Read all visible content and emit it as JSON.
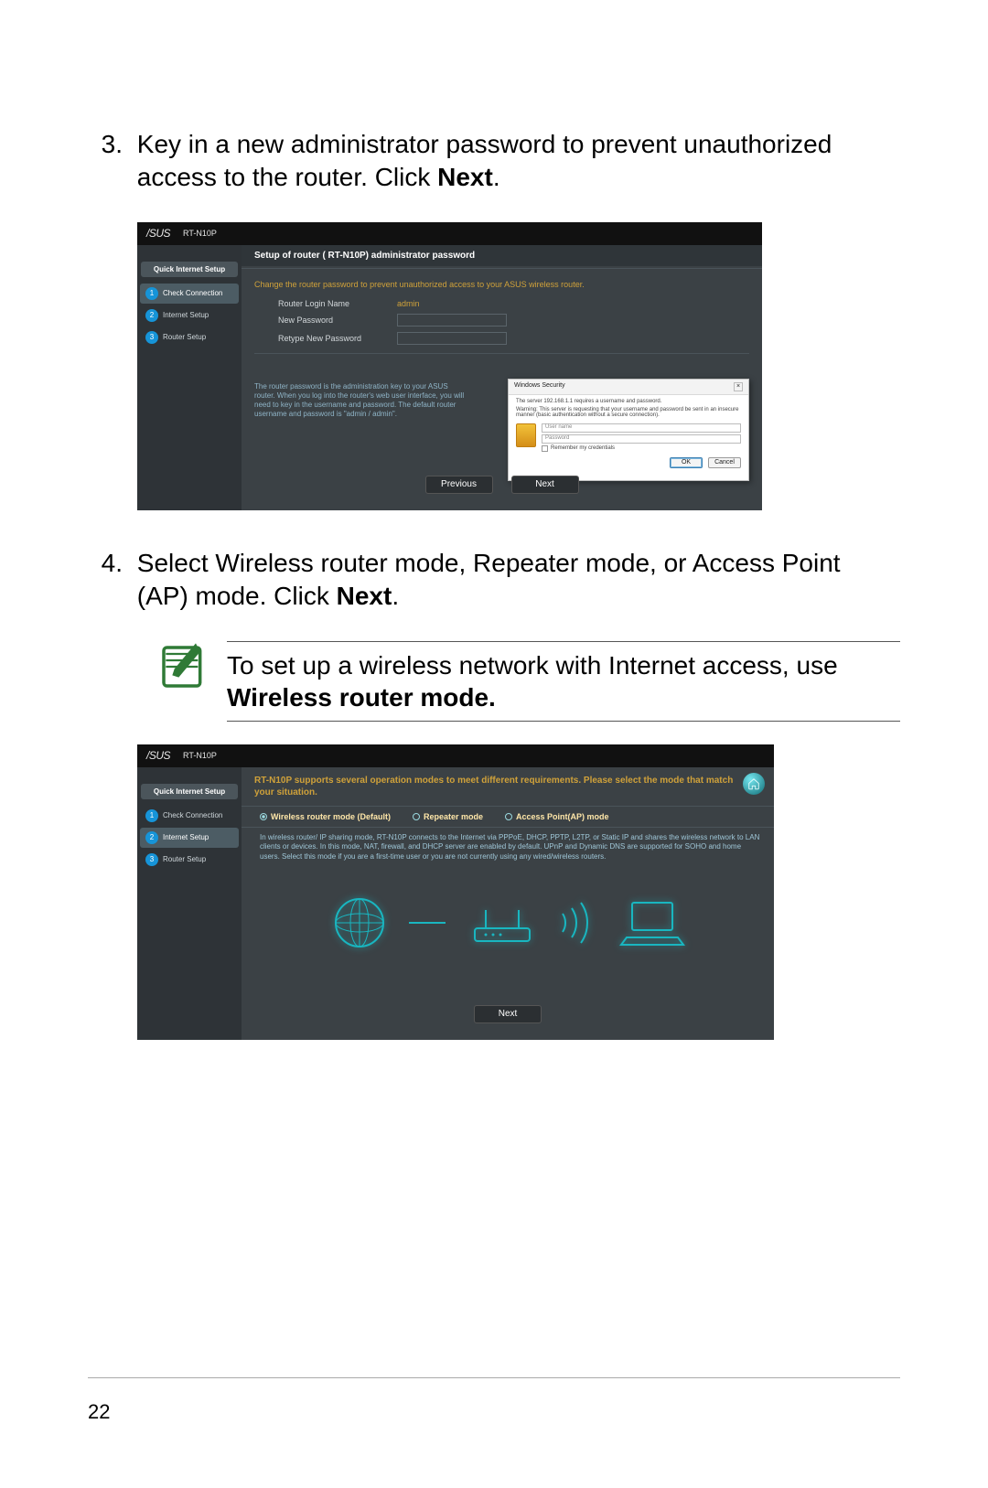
{
  "page_number": "22",
  "steps": {
    "s3": {
      "num": "3.",
      "text_a": "Key in a new administrator password to prevent unauthorized access to the router. Click ",
      "bold": "Next",
      "text_b": "."
    },
    "s4": {
      "num": "4.",
      "text_a": "Select Wireless router mode, Repeater mode, or Access Point (AP) mode. Click ",
      "bold": "Next",
      "text_b": "."
    }
  },
  "tip": {
    "text_a": "To set up a wireless network with Internet access, use ",
    "bold": "Wireless router mode."
  },
  "shot1": {
    "brand": "/SUS",
    "model": "RT-N10P",
    "sidebar_title": "Quick Internet Setup",
    "sidebar_items": [
      {
        "n": "1",
        "label": "Check Connection"
      },
      {
        "n": "2",
        "label": "Internet Setup"
      },
      {
        "n": "3",
        "label": "Router Setup"
      }
    ],
    "panel_head": "Setup of router ( RT-N10P) administrator password",
    "instr": "Change the router password to prevent unauthorized access to your ASUS wireless router.",
    "rows": {
      "login_label": "Router Login Name",
      "login_val": "admin",
      "new_label": "New Password",
      "retype_label": "Retype New Password"
    },
    "help": "The router password is the administration key to your ASUS router. When you log into the router's web user interface, you will need to key in the username and password. The default router username and password is \"admin / admin\".",
    "popup": {
      "title": "Windows Security",
      "close": "×",
      "line": "The server 192.168.1.1 requires a username and password.",
      "warn": "Warning: This server is requesting that your username and password be sent in an insecure manner (basic authentication without a secure connection).",
      "user_ph": "User name",
      "pass_ph": "Password",
      "remember": "Remember my credentials",
      "ok": "OK",
      "cancel": "Cancel"
    },
    "prev": "Previous",
    "next": "Next"
  },
  "shot2": {
    "brand": "/SUS",
    "model": "RT-N10P",
    "sidebar_title": "Quick Internet Setup",
    "sidebar_items": [
      {
        "n": "1",
        "label": "Check Connection"
      },
      {
        "n": "2",
        "label": "Internet Setup"
      },
      {
        "n": "3",
        "label": "Router Setup"
      }
    ],
    "head": "RT-N10P supports several operation modes to meet different requirements. Please select the mode that match your situation.",
    "opts": [
      "Wireless router mode (Default)",
      "Repeater mode",
      "Access Point(AP) mode"
    ],
    "desc": "In wireless router/ IP sharing mode, RT-N10P connects to the Internet via PPPoE, DHCP, PPTP, L2TP, or Static IP and shares the wireless network to LAN clients or devices. In this mode, NAT, firewall, and DHCP server are enabled by default. UPnP and Dynamic DNS are supported for SOHO and home users. Select this mode if you are a first-time user or you are not currently using any wired/wireless routers.",
    "next": "Next"
  }
}
